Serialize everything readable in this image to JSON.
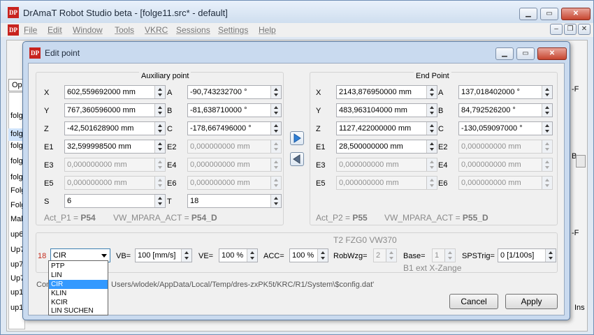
{
  "app": {
    "title": "DrAmaT Robot Studio beta - [folge11.src* - default]",
    "logo_text": "DP",
    "menu": [
      "File",
      "Edit",
      "Window",
      "Tools",
      "VKRC",
      "Sessions",
      "Settings",
      "Help"
    ],
    "side_items": [
      "folg",
      "folg",
      "folg",
      "folg",
      "folg",
      "Folg",
      "Folg",
      "Mak",
      "up6",
      "Up7",
      "up7",
      "Up7",
      "up1",
      "up1"
    ],
    "side_tab": "Op",
    "right_items": [
      "-F",
      "B",
      "-F",
      "Ins"
    ]
  },
  "dialog": {
    "title": "Edit point",
    "aux": {
      "title": "Auxiliary point",
      "fields": [
        {
          "label": "X",
          "value": "602,559692000 mm"
        },
        {
          "label": "A",
          "value": "-90,743232700 °"
        },
        {
          "label": "Y",
          "value": "767,360596000 mm"
        },
        {
          "label": "B",
          "value": "-81,638710000 °"
        },
        {
          "label": "Z",
          "value": "-42,501628900 mm"
        },
        {
          "label": "C",
          "value": "-178,667496000 °"
        },
        {
          "label": "E1",
          "value": "32,599998500 mm"
        },
        {
          "label": "E2",
          "value": "0,000000000 mm"
        },
        {
          "label": "E3",
          "value": "0,000000000 mm"
        },
        {
          "label": "E4",
          "value": "0,000000000 mm"
        },
        {
          "label": "E5",
          "value": "0,000000000 mm"
        },
        {
          "label": "E6",
          "value": "0,000000000 mm"
        },
        {
          "label": "S",
          "value": "6"
        },
        {
          "label": "T",
          "value": "18"
        }
      ],
      "footer_left_prefix": "Act_P1 = ",
      "footer_left_value": "P54",
      "footer_right_prefix": "VW_MPARA_ACT = ",
      "footer_right_value": "P54_D"
    },
    "end": {
      "title": "End Point",
      "fields": [
        {
          "label": "X",
          "value": "2143,876950000 mm"
        },
        {
          "label": "A",
          "value": "137,018402000 °"
        },
        {
          "label": "Y",
          "value": "483,963104000 mm"
        },
        {
          "label": "B",
          "value": "84,792526200 °"
        },
        {
          "label": "Z",
          "value": "1127,422000000 mm"
        },
        {
          "label": "C",
          "value": "-130,059097000 °"
        },
        {
          "label": "E1",
          "value": "28,500000000 mm"
        },
        {
          "label": "E2",
          "value": "0,000000000 mm"
        },
        {
          "label": "E3",
          "value": "0,000000000 mm"
        },
        {
          "label": "E4",
          "value": "0,000000000 mm"
        },
        {
          "label": "E5",
          "value": "0,000000000 mm"
        },
        {
          "label": "E6",
          "value": "0,000000000 mm"
        }
      ],
      "footer_left_prefix": "Act_P2 = ",
      "footer_left_value": "P55",
      "footer_right_prefix": "VW_MPARA_ACT = ",
      "footer_right_value": "P55_D"
    },
    "motion": {
      "line_number": "18",
      "header": "T2 FZG0 VW370",
      "footer": "B1 ext X-Zange",
      "type_value": "CIR",
      "type_options": [
        "PTP",
        "LIN",
        "CIR",
        "KLIN",
        "KCIR",
        "LIN SUCHEN"
      ],
      "vb_label": "VB=",
      "vb_value": "100 [mm/s]",
      "ve_label": "VE=",
      "ve_value": "100 %",
      "acc_label": "ACC=",
      "acc_value": "100 %",
      "robwzg_label": "RobWzg=",
      "robwzg_value": "2",
      "base_label": "Base=",
      "base_value": "1",
      "spstrig_label": "SPSTrig=",
      "spstrig_value": "0 [1/100s]"
    },
    "config_text_left": "Con",
    "config_text_right": "Users/wlodek/AppData/Local/Temp/dres-zxPK5t/KRC/R1/System\\$config.dat'",
    "cancel_label": "Cancel",
    "apply_label": "Apply"
  }
}
